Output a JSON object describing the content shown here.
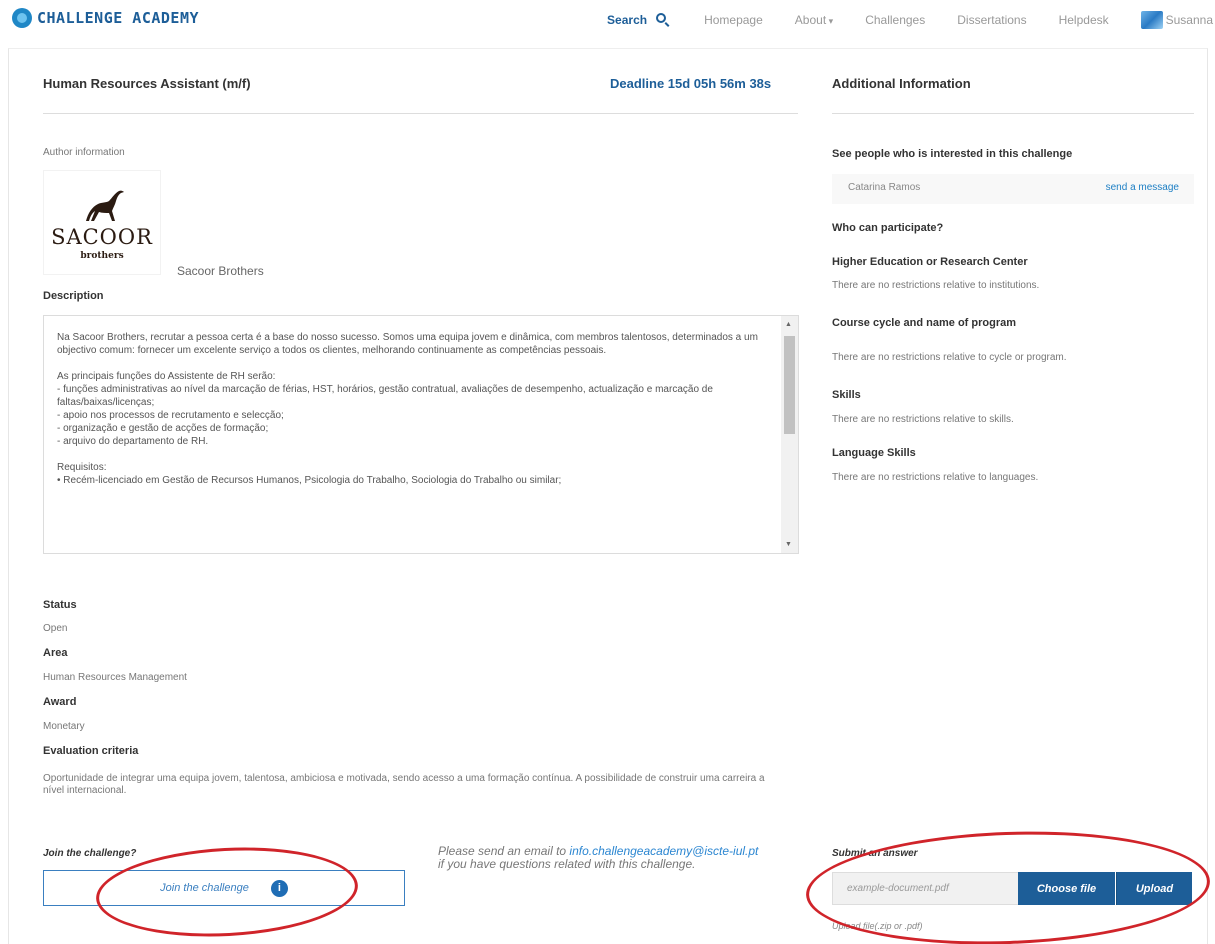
{
  "brand": {
    "name": "CHALLENGE ACADEMY"
  },
  "nav": {
    "search": "Search",
    "items": [
      "Homepage",
      "About",
      "Challenges",
      "Dissertations",
      "Helpdesk"
    ],
    "user": "Susanna"
  },
  "challenge": {
    "title": "Human Resources Assistant (m/f)",
    "deadline": "Deadline 15d 05h 56m 38s",
    "author_label": "Author information",
    "company_logo_text": "SACOOR",
    "company_logo_sub": "brothers",
    "company_name": "Sacoor Brothers",
    "description_label": "Description",
    "description": "Na Sacoor Brothers, recrutar a pessoa certa é a base do nosso sucesso. Somos uma equipa jovem e dinâmica, com membros talentosos, determinados a um objectivo comum: fornecer um excelente serviço a todos os clientes, melhorando continuamente as competências pessoais.\n\nAs principais funções do Assistente de RH serão:\n- funções administrativas ao nível da marcação de férias, HST, horários, gestão contratual, avaliações de desempenho, actualização e marcação de faltas/baixas/licenças;\n- apoio nos processos de recrutamento e selecção;\n- organização e gestão de acções de formação;\n- arquivo do departamento de RH.\n\nRequisitos:\n• Recém-licenciado em Gestão de Recursos Humanos, Psicologia do Trabalho, Sociologia do Trabalho ou similar;",
    "status_label": "Status",
    "status": "Open",
    "area_label": "Area",
    "area": "Human Resources Management",
    "award_label": "Award",
    "award": "Monetary",
    "evaluation_label": "Evaluation criteria",
    "evaluation": "Oportunidade de integrar uma equipa jovem, talentosa, ambiciosa e motivada, sendo acesso a uma formação contínua. A possibilidade de construir uma carreira a nível internacional."
  },
  "additional": {
    "title": "Additional Information",
    "interested_label": "See people who is interested in this challenge",
    "person": "Catarina Ramos",
    "send_message": "send a message",
    "who_label": "Who can participate?",
    "hei_label": "Higher Education or Research Center",
    "hei_text": "There are no restrictions relative to institutions.",
    "course_label": "Course cycle and name of program",
    "course_text": "There are no restrictions relative to cycle or program.",
    "skills_label": "Skills",
    "skills_text": "There are no restrictions relative to skills.",
    "lang_label": "Language Skills",
    "lang_text": "There are no restrictions relative to languages."
  },
  "actions": {
    "join_label": "Join the challenge?",
    "join_button": "Join the challenge",
    "info_icon": "i",
    "email_prefix": "Please send an email to ",
    "email": "info.challengeacademy@iscte-iul.pt",
    "email_suffix": "if you have questions related with this challenge.",
    "submit_label": "Submit an answer",
    "file_placeholder": "example-document.pdf",
    "choose_file": "Choose file",
    "upload": "Upload",
    "upload_hint": "Upload file(.zip or .pdf)"
  },
  "colors": {
    "brand_blue": "#1d5e98",
    "link_blue": "#2b86d1",
    "annotation_red": "#d0242a"
  }
}
